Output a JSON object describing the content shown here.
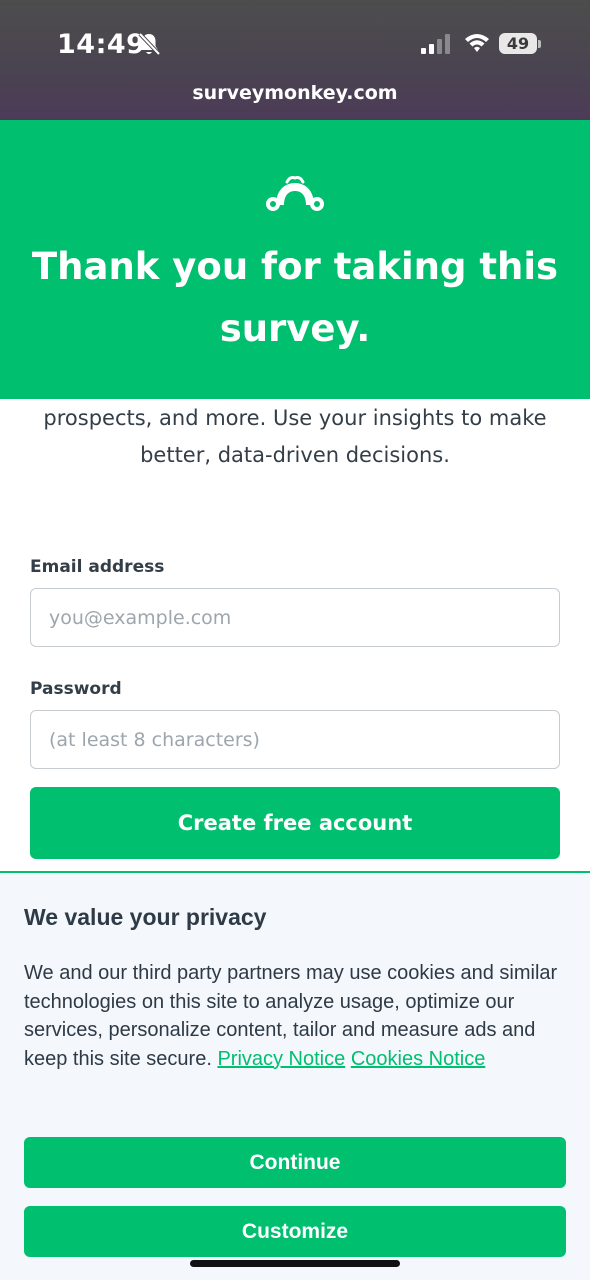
{
  "status_bar": {
    "time": "14:49",
    "battery_level": "49",
    "url": "surveymonkey.com",
    "icons": [
      "bell-slash-icon",
      "signal-icon",
      "wifi-icon",
      "battery-icon"
    ]
  },
  "hero": {
    "logo_icon": "surveymonkey-logo-icon",
    "title": "Thank you for taking this survey.",
    "background_color": "#00bf6f"
  },
  "intro": {
    "text": "prospects, and more. Use your insights to make better, data-driven decisions."
  },
  "signup_form": {
    "email_label": "Email address",
    "email_placeholder": "you@example.com",
    "email_value": "",
    "password_label": "Password",
    "password_placeholder": "(at least 8 characters)",
    "password_value": "",
    "submit_label": "Create free account"
  },
  "privacy_banner": {
    "title": "We value your privacy",
    "text": "We and our third party partners may use cookies and similar technologies on this site to analyze usage, optimize our services, personalize content, tailor and measure ads and keep this site secure.",
    "privacy_link": "Privacy Notice",
    "cookies_link": "Cookies Notice",
    "continue_label": "Continue",
    "customize_label": "Customize"
  },
  "colors": {
    "brand_green": "#00bf6f",
    "text_dark": "#333e48",
    "banner_bg": "#f4f7fb"
  }
}
